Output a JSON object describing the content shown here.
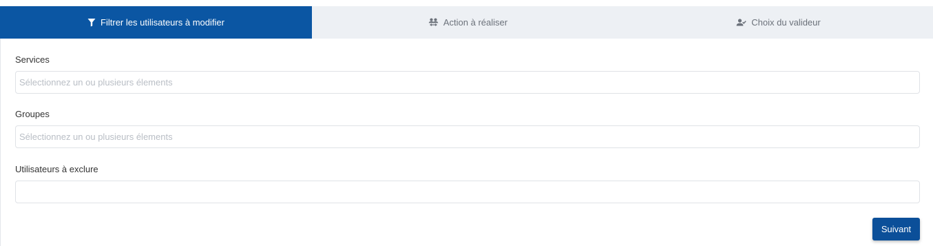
{
  "tabs": [
    {
      "label": "Filtrer les utilisateurs à modifier",
      "icon": "filter-icon",
      "active": true
    },
    {
      "label": "Action à réaliser",
      "icon": "users-swap-icon",
      "active": false
    },
    {
      "label": "Choix du valideur",
      "icon": "user-check-icon",
      "active": false
    }
  ],
  "form": {
    "services": {
      "label": "Services",
      "placeholder": "Sélectionnez un ou plusieurs élements",
      "value": ""
    },
    "groupes": {
      "label": "Groupes",
      "placeholder": "Sélectionnez un ou plusieurs élements",
      "value": ""
    },
    "exclude": {
      "label": "Utilisateurs à exclure",
      "placeholder": "",
      "value": ""
    }
  },
  "actions": {
    "next_label": "Suivant"
  },
  "colors": {
    "primary": "#0b56a3",
    "tab_inactive_bg": "#edf0f4",
    "button": "#0b4f99"
  }
}
